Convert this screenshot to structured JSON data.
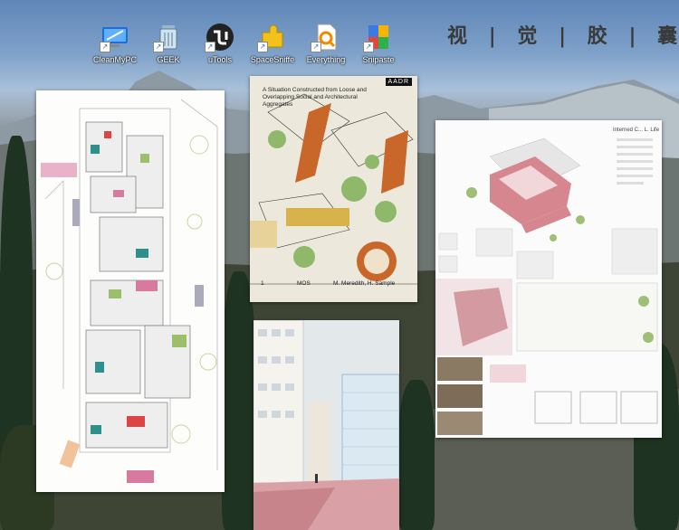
{
  "desktop": {
    "icons": [
      {
        "label": "CleanMyPC",
        "icon": "cleanmypc-icon"
      },
      {
        "label": "GEEK",
        "icon": "geek-trash-icon"
      },
      {
        "label": "uTools",
        "icon": "utools-icon"
      },
      {
        "label": "SpaceSniffe",
        "icon": "spacesniffer-icon"
      },
      {
        "label": "Everything",
        "icon": "everything-search-icon"
      },
      {
        "label": "Snipaste",
        "icon": "snipaste-icon"
      }
    ],
    "title_chars": [
      "视",
      "|",
      "觉",
      "|",
      "胶",
      "|",
      "囊"
    ]
  },
  "posters": {
    "aadr": {
      "badge": "AADR",
      "heading": "A Situation Constructed from Loose and Overlapping Social and Architectural Aggregates",
      "footer_num": "1",
      "footer_left": "MOS",
      "footer_right": "M. Meredith, H. Sample"
    },
    "sheet": {
      "heading": "Interned C... L. Life"
    }
  },
  "colors": {
    "accent_red": "#c0394b",
    "plan_green": "#9bbf6b",
    "plan_pink": "#d87aa0",
    "plan_teal": "#2f8f8a"
  }
}
